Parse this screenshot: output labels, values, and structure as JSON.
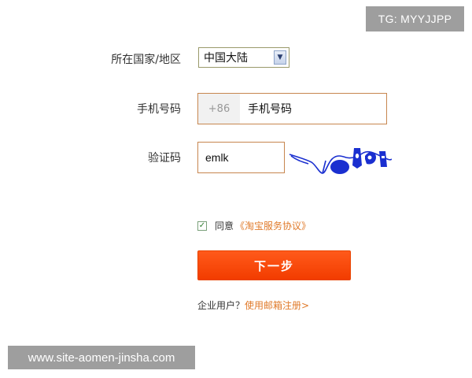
{
  "overlay": {
    "tg": "TG: MYYJJPP",
    "website": "www.site-aomen-jinsha.com"
  },
  "form": {
    "region_label": "所在国家/地区",
    "region_value": "中国大陆",
    "phone_label": "手机号码",
    "phone_prefix": "+86",
    "phone_value": "手机号码",
    "code_label": "验证码",
    "code_value": "emlk",
    "agree_checked": true,
    "agree_text": "同意",
    "agree_link": "《淘宝服务协议》",
    "next_button": "下一步",
    "enterprise_text": "企业用户？",
    "enterprise_link": "使用邮箱注册>"
  },
  "colors": {
    "accent": "#f23c00",
    "link": "#e07a2a",
    "input_border": "#c7864f",
    "captcha_ink": "#1a2fd0"
  },
  "icons": {
    "select_arrow": "chevron-down-icon",
    "checkbox": "checkmark-icon"
  }
}
